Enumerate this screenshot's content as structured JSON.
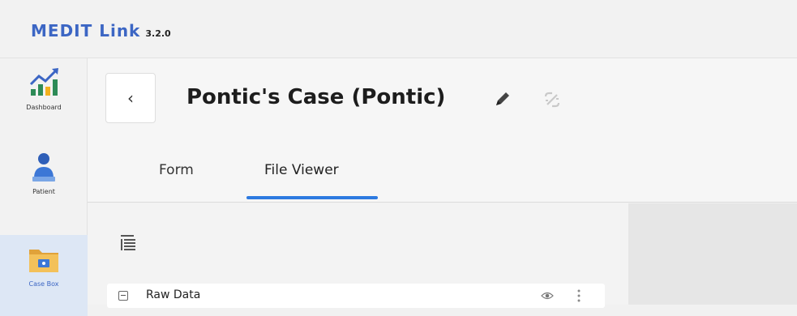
{
  "app": {
    "name": "MEDIT Link",
    "version": "3.2.0"
  },
  "sidebar": {
    "items": [
      {
        "label": "Dashboard",
        "icon": "chart-icon"
      },
      {
        "label": "Patient",
        "icon": "patient-icon"
      },
      {
        "label": "Case Box",
        "icon": "folder-icon",
        "active": true
      }
    ]
  },
  "case": {
    "title": "Pontic's Case (Pontic)",
    "back_icon": "chevron-left-icon",
    "edit_icon": "pencil-icon",
    "link_icon": "unlink-icon"
  },
  "tabs": [
    {
      "label": "Form",
      "active": false
    },
    {
      "label": "File Viewer",
      "active": true
    }
  ],
  "file_tree": {
    "toolbar_icon": "tree-list-icon",
    "rows": [
      {
        "label": "Raw Data",
        "expanded": true,
        "visible": true
      }
    ]
  },
  "colors": {
    "brand": "#3c66c4",
    "accent": "#2d7ae0",
    "active_nav_bg": "#dde7f5"
  }
}
